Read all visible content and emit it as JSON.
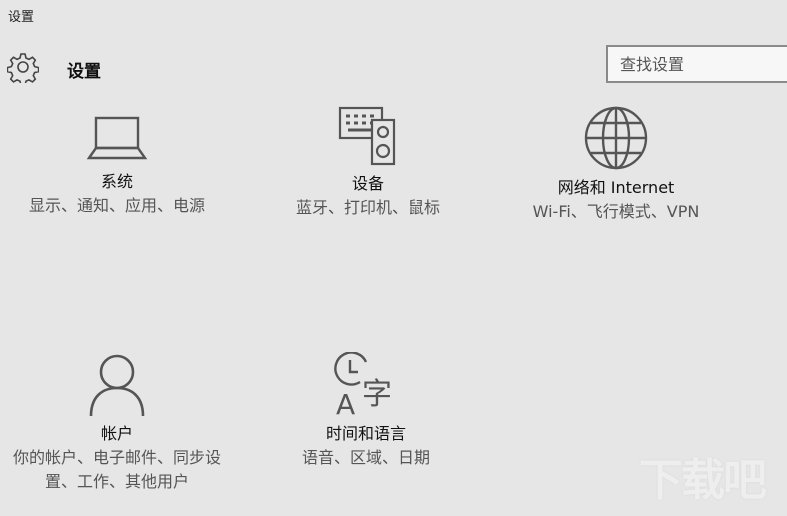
{
  "window": {
    "title": "设置"
  },
  "header": {
    "title": "设置",
    "icon": "gear-icon"
  },
  "search": {
    "placeholder": "查找设置",
    "value": ""
  },
  "tiles": [
    {
      "name": "系统",
      "desc": "显示、通知、应用、电源",
      "icon": "laptop-icon"
    },
    {
      "name": "设备",
      "desc": "蓝牙、打印机、鼠标",
      "icon": "devices-icon"
    },
    {
      "name": "网络和 Internet",
      "desc": "Wi-Fi、飞行模式、VPN",
      "icon": "globe-icon"
    },
    {
      "name": "帐户",
      "desc": "你的帐户、电子邮件、同步设置、工作、其他用户",
      "icon": "person-icon"
    },
    {
      "name": "时间和语言",
      "desc": "语音、区域、日期",
      "icon": "time-language-icon"
    }
  ],
  "watermark": {
    "text": "下载吧"
  }
}
